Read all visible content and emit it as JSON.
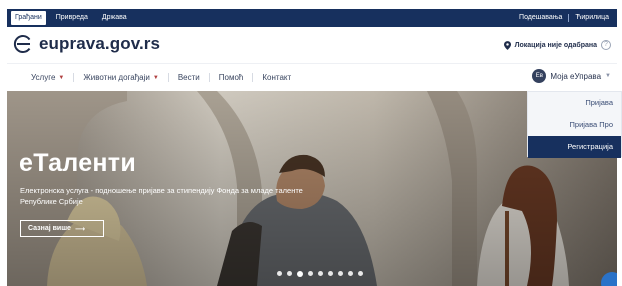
{
  "topbar": {
    "tabs": [
      "Грађани",
      "Привреда",
      "Држава"
    ],
    "right_links": [
      "Подешавања",
      "Ћирилица"
    ]
  },
  "header": {
    "site_name": "euprava.gov.rs",
    "location_text": "Локација није одабрана",
    "help_glyph": "?"
  },
  "nav": {
    "items": [
      "Услуге",
      "Животни догађаји",
      "Вести",
      "Помоћ",
      "Контакт"
    ],
    "account_avatar": "Ев",
    "account_label": "Моја еУправа"
  },
  "dropdown": {
    "items": [
      "Пријава",
      "Пријава Про",
      "Регистрација"
    ],
    "active_item": "Регистрација"
  },
  "hero": {
    "title": "еТаленти",
    "description": "Електронска услуга - подношење пријаве за стипендију Фонда за младе таленте Републике Србије",
    "button_label": "Сазнај више",
    "slide_count": 9,
    "active_slide": 2
  },
  "colors": {
    "brand_navy": "#17305e",
    "accent_red": "#b04040",
    "chat_blue": "#2a72c8"
  },
  "icons": [
    "location-pin-icon",
    "help-icon",
    "chevron-down-icon",
    "arrow-right-icon",
    "chat-icon",
    "logo-e-icon"
  ]
}
